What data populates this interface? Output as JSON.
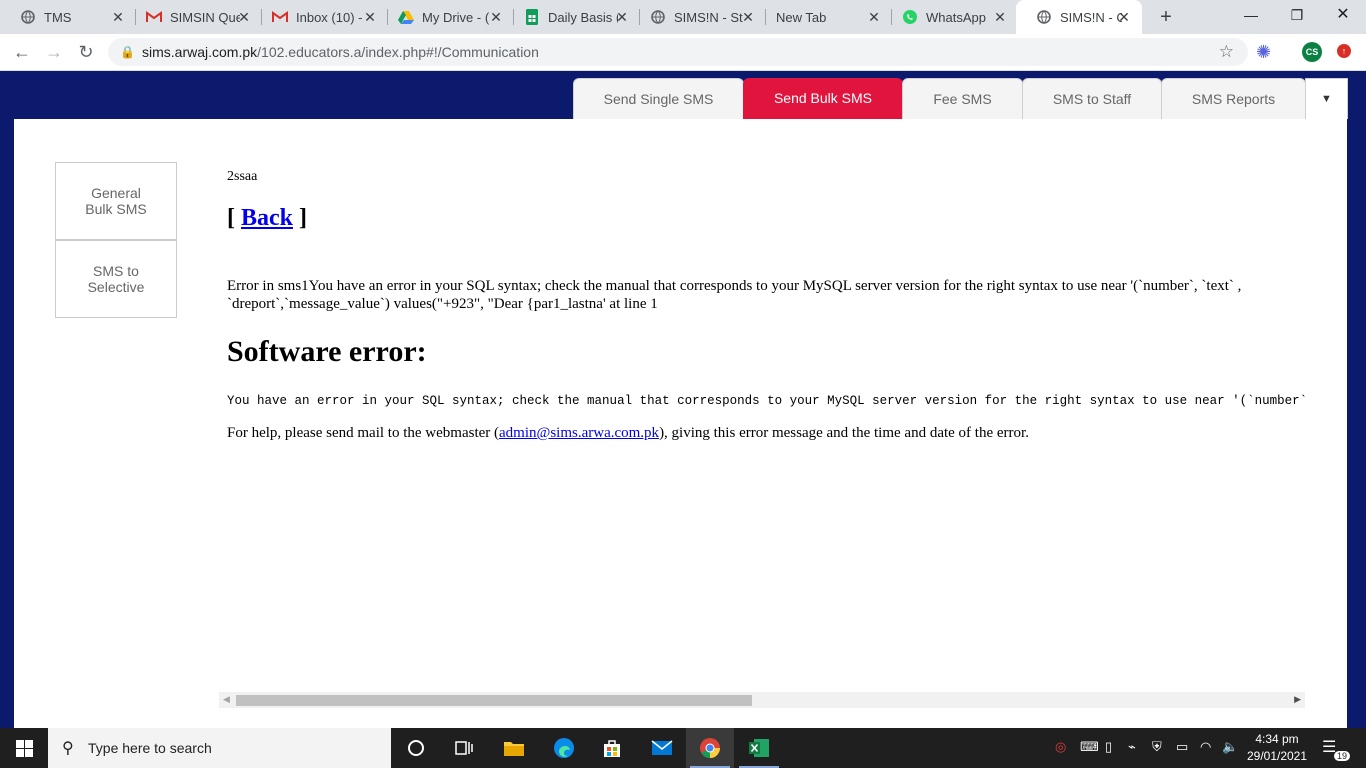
{
  "browser": {
    "tabs": [
      {
        "title": "TMS",
        "icon": "globe-icon"
      },
      {
        "title": "SIMSIN Que",
        "icon": "gmail-icon"
      },
      {
        "title": "Inbox (10) -",
        "icon": "gmail-icon"
      },
      {
        "title": "My Drive - (",
        "icon": "google-drive-icon"
      },
      {
        "title": "Daily Basis (",
        "icon": "google-sheets-icon"
      },
      {
        "title": "SIMS!N - St",
        "icon": "globe-icon"
      },
      {
        "title": "New Tab",
        "icon": ""
      },
      {
        "title": "WhatsApp",
        "icon": "whatsapp-icon"
      },
      {
        "title": "SIMS!N - Cc",
        "icon": "globe-icon",
        "active": true
      }
    ],
    "url_host": "sims.arwaj.com.pk",
    "url_path": "/102.educators.a/index.php#!/Communication",
    "profile_initials": "CS"
  },
  "app_tabs": {
    "single": "Send Single SMS",
    "bulk": "Send Bulk SMS",
    "fee": "Fee SMS",
    "staff": "SMS to Staff",
    "reports": "SMS Reports"
  },
  "sidebar": {
    "general": "General Bulk SMS",
    "selective": "SMS to Selective"
  },
  "error": {
    "code": "2ssaa",
    "back_open": "[ ",
    "back_link": "Back",
    "back_close": " ]",
    "message": "Error in sms1You have an error in your SQL syntax; check the manual that corresponds to your MySQL server version for the right syntax to use near '(`number`, `text` , `dreport`,`message_value`) values(\"+923\", \"Dear {par1_lastna' at line 1",
    "heading": "Software error:",
    "mono": "You have an error in your SQL syntax; check the manual that corresponds to your MySQL server version for the right syntax to use near '(`number`, `text",
    "help_before": "For help, please send mail to the webmaster (",
    "help_email": "admin@sims.arwa.com.pk",
    "help_after": "), giving this error message and the time and date of the error."
  },
  "taskbar": {
    "search_placeholder": "Type here to search",
    "time": "4:34 pm",
    "date": "29/01/2021",
    "notification_count": "19"
  },
  "colors": {
    "page_navy": "#0c1a6e",
    "active_tab_red": "#e0143c"
  }
}
